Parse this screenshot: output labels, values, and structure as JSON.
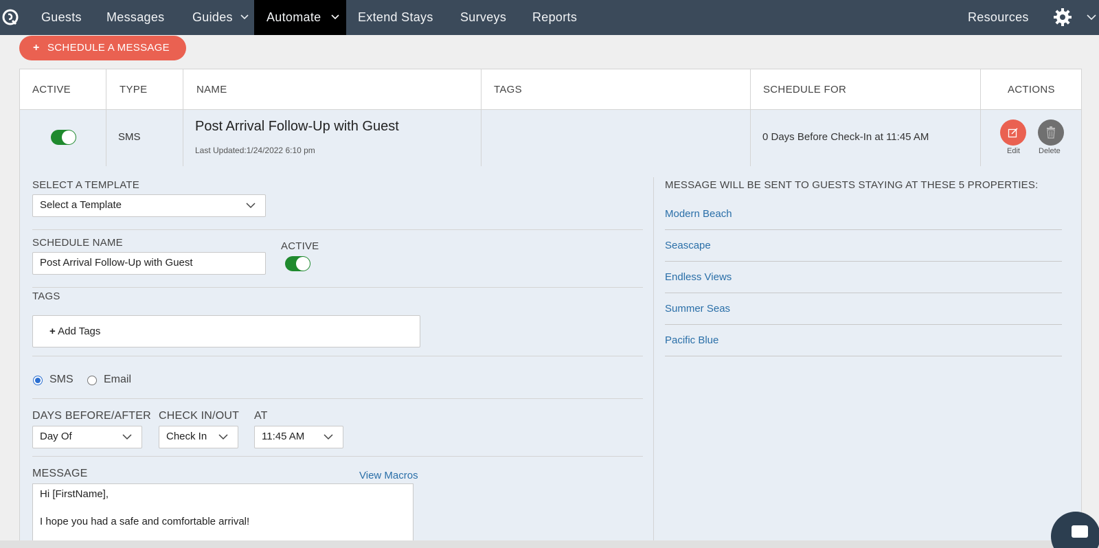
{
  "nav": {
    "items": [
      {
        "label": "Guests"
      },
      {
        "label": "Messages"
      },
      {
        "label": "Guides"
      },
      {
        "label": "Automate"
      },
      {
        "label": "Extend Stays"
      },
      {
        "label": "Surveys"
      },
      {
        "label": "Reports"
      }
    ],
    "resources": "Resources"
  },
  "schedule_button": {
    "plus": "+",
    "label": "SCHEDULE A MESSAGE"
  },
  "table": {
    "headers": {
      "active": "ACTIVE",
      "type": "TYPE",
      "name": "NAME",
      "tags": "TAGS",
      "schedule_for": "SCHEDULE FOR",
      "actions": "ACTIONS"
    },
    "row": {
      "type": "SMS",
      "name": "Post Arrival Follow-Up with Guest",
      "last_updated": "Last Updated:1/24/2022 6:10 pm",
      "schedule_for": "0 Days Before Check-In at 11:45 AM",
      "edit_label": "Edit",
      "delete_label": "Delete"
    }
  },
  "form": {
    "template_label": "SELECT A TEMPLATE",
    "template_value": "Select a Template",
    "schedule_name_label": "SCHEDULE NAME",
    "schedule_name_value": "Post Arrival Follow-Up with Guest",
    "active_label": "ACTIVE",
    "tags_label": "TAGS",
    "add_tags": "Add Tags",
    "add_tags_plus": "+",
    "radio_sms": "SMS",
    "radio_email": "Email",
    "days_label": "DAYS BEFORE/AFTER",
    "days_value": "Day Of",
    "check_label": "CHECK IN/OUT",
    "check_value": "Check In",
    "at_label": "AT",
    "at_value": "11:45 AM",
    "message_label": "MESSAGE",
    "view_macros": "View Macros",
    "message_lines": [
      "Hi [FirstName],",
      "I hope you had a safe and comfortable arrival!"
    ]
  },
  "properties": {
    "heading": "MESSAGE WILL BE SENT TO GUESTS STAYING AT THESE 5 PROPERTIES:",
    "list": [
      "Modern Beach",
      "Seascape",
      "Endless Views",
      "Summer Seas",
      "Pacific Blue"
    ]
  },
  "colors": {
    "nav_bg": "#3b4a5a",
    "accent": "#ea6151",
    "toggle_on": "#1f8a2e",
    "link": "#2a6fa8"
  }
}
